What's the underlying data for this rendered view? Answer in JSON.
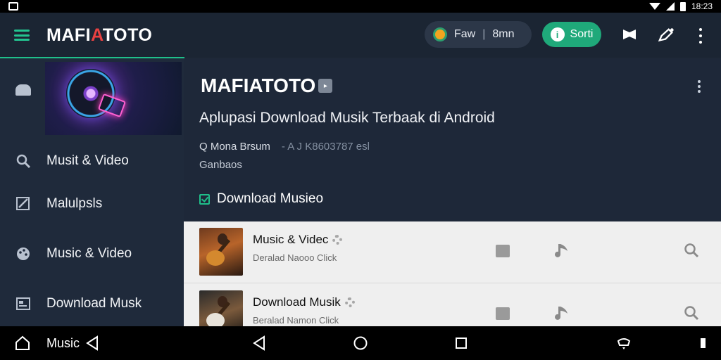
{
  "status_bar": {
    "time": "18:23",
    "icons": [
      "app-icon",
      "wifi-icon",
      "signal-icon",
      "battery-icon"
    ]
  },
  "app_bar": {
    "brand_left": "MAFI",
    "brand_accent": "A",
    "brand_right": "TOTO",
    "pill_left": "Faw",
    "pill_separator": "|",
    "pill_right": "8mn",
    "sorti_label": "Sorti",
    "sorti_icon": "i",
    "accent_color": "#1fa97a",
    "brand_accent_color": "#e84141"
  },
  "sidebar": {
    "items": [
      {
        "label": "Musit & Video",
        "icon": "search-icon"
      },
      {
        "label": "Malulpsls",
        "icon": "edit-icon"
      },
      {
        "label": "Music & Video",
        "icon": "palette-icon"
      },
      {
        "label": "Download Musk",
        "icon": "list-icon"
      }
    ]
  },
  "main": {
    "title": "MAFIATOTO",
    "title_badge": "▸",
    "subtitle": "Aplupasi Download Musik Terbaak di Android",
    "meta_primary": "Q Mona Brsum",
    "meta_faint": "- A J K8603787 esl",
    "meta_secondary": "Ganbaos",
    "download_label": "Download Musieo"
  },
  "list": {
    "rows": [
      {
        "title": "Music & Videc",
        "subtitle": "Deralad Naooo Click"
      },
      {
        "title": "Download Musik",
        "subtitle": "Beralad Namon Click"
      }
    ]
  },
  "nav_bar": {
    "label": "Music"
  }
}
